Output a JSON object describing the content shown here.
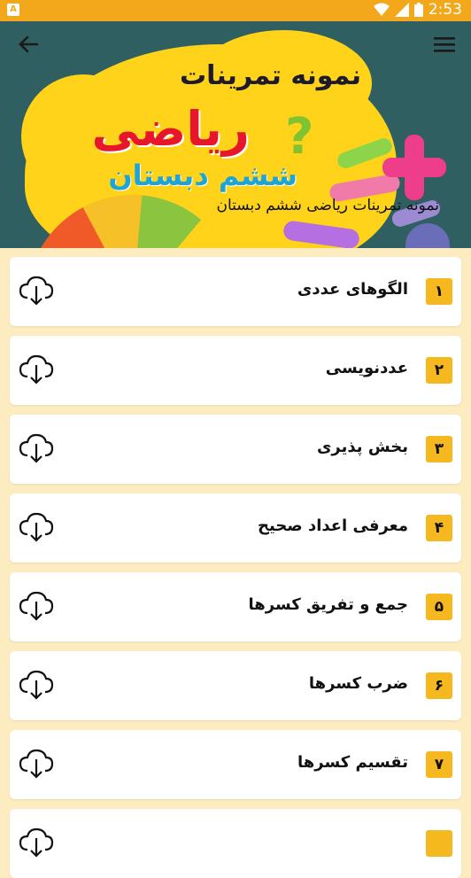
{
  "statusbar": {
    "left_icon": "A",
    "time": "2:53"
  },
  "header": {
    "title_line": "نمونه تمرینات",
    "big_word": "ریاضی",
    "sub_word": "ششم دبستان",
    "caption": "نمونه تمرینات ریاضی ششم دبستان"
  },
  "items": [
    {
      "num": "۱",
      "title": "الگوهای عددی"
    },
    {
      "num": "۲",
      "title": "عددنویسی"
    },
    {
      "num": "۳",
      "title": "بخش پذیری"
    },
    {
      "num": "۴",
      "title": "معرفی اعداد صحیح"
    },
    {
      "num": "۵",
      "title": "جمع و تفریق کسرها"
    },
    {
      "num": "۶",
      "title": "ضرب کسرها"
    },
    {
      "num": "۷",
      "title": "تقسیم کسرها"
    },
    {
      "num": "",
      "title": ""
    }
  ],
  "colors": {
    "status": "#f3a81b",
    "accent": "#f6b81f",
    "background": "#fdecc0"
  }
}
